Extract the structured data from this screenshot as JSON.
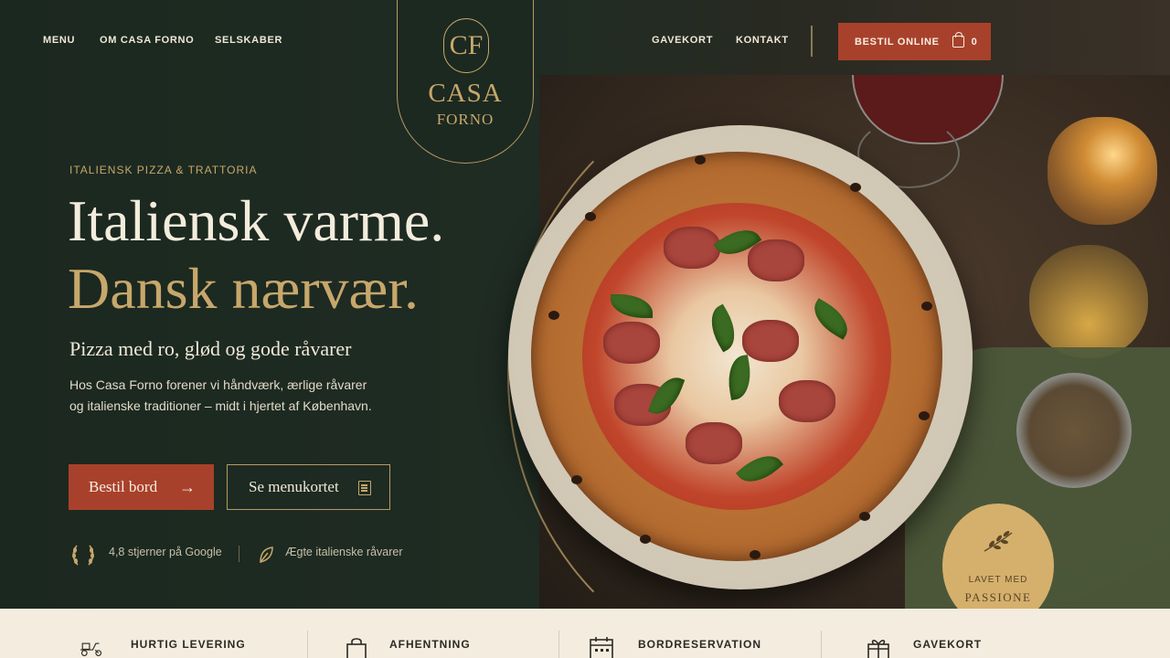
{
  "nav": {
    "left": [
      "MENU",
      "OM CASA FORNO",
      "SELSKABER"
    ],
    "right": [
      "GAVEKORT",
      "KONTAKT"
    ],
    "order_label": "BESTIL ONLINE",
    "cart_count": "0"
  },
  "logo": {
    "monogram": "CF",
    "name": "CASA",
    "sub": "FORNO"
  },
  "hero": {
    "eyebrow": "ITALIENSK PIZZA & TRATTORIA",
    "headline_1": "Italiensk varme.",
    "headline_2": "Dansk nærvær.",
    "subheadline": "Pizza med ro, glød og gode råvarer",
    "body": "Hos Casa Forno forener vi håndværk, ærlige råvarer og italienske traditioner – midt i hjertet af København.",
    "cta_primary": "Bestil bord",
    "cta_secondary": "Se menukortet",
    "trust_1": "4,8 stjerner på Google",
    "trust_2": "Ægte italienske råvarer"
  },
  "badge": {
    "small": "LAVET MED",
    "big": "PASSIONE"
  },
  "features": [
    "HURTIG LEVERING",
    "AFHENTNING",
    "BORDRESERVATION",
    "GAVEKORT"
  ],
  "colors": {
    "background": "#1d2a21",
    "accent_red": "#a8412b",
    "gold": "#c7a76b",
    "cream": "#f3ecdf"
  }
}
